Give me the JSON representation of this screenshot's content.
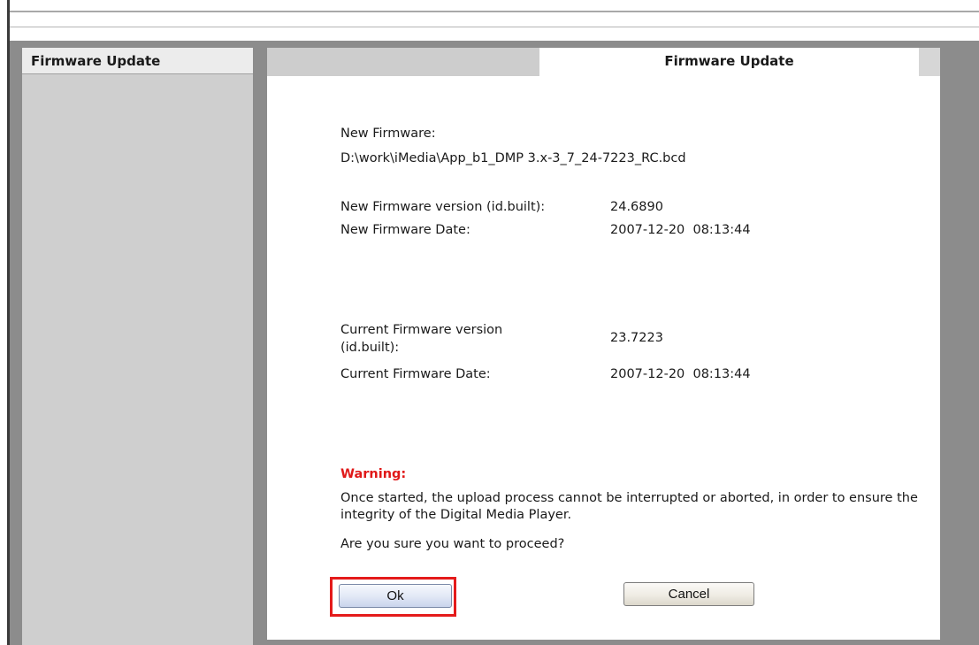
{
  "nav": {
    "title": "Firmware Update"
  },
  "panel": {
    "tab_title": "Firmware Update",
    "new_firmware": {
      "label": "New Firmware:",
      "path": "D:\\work\\iMedia\\App_b1_DMP 3.x-3_7_24-7223_RC.bcd",
      "version_label": "New Firmware version (id.built):",
      "version_value": "24.6890",
      "date_label": "New Firmware Date:",
      "date_value": "2007-12-20  08:13:44"
    },
    "current_firmware": {
      "version_label_line1": "Current Firmware version",
      "version_label_line2": "(id.built):",
      "version_value": "23.7223",
      "date_label": "Current Firmware Date:",
      "date_value": "2007-12-20  08:13:44"
    },
    "warning": {
      "title": "Warning:",
      "text": "Once started, the upload process cannot be interrupted or aborted, in order to ensure the integrity of the Digital Media Player.",
      "question": "Are you sure you want to proceed?"
    },
    "buttons": {
      "ok": "Ok",
      "cancel": "Cancel"
    }
  },
  "colors": {
    "warning": "#e01818",
    "highlight": "#e41b1b",
    "frame": "#8c8c8c",
    "nav_body": "#cfcfcf"
  }
}
